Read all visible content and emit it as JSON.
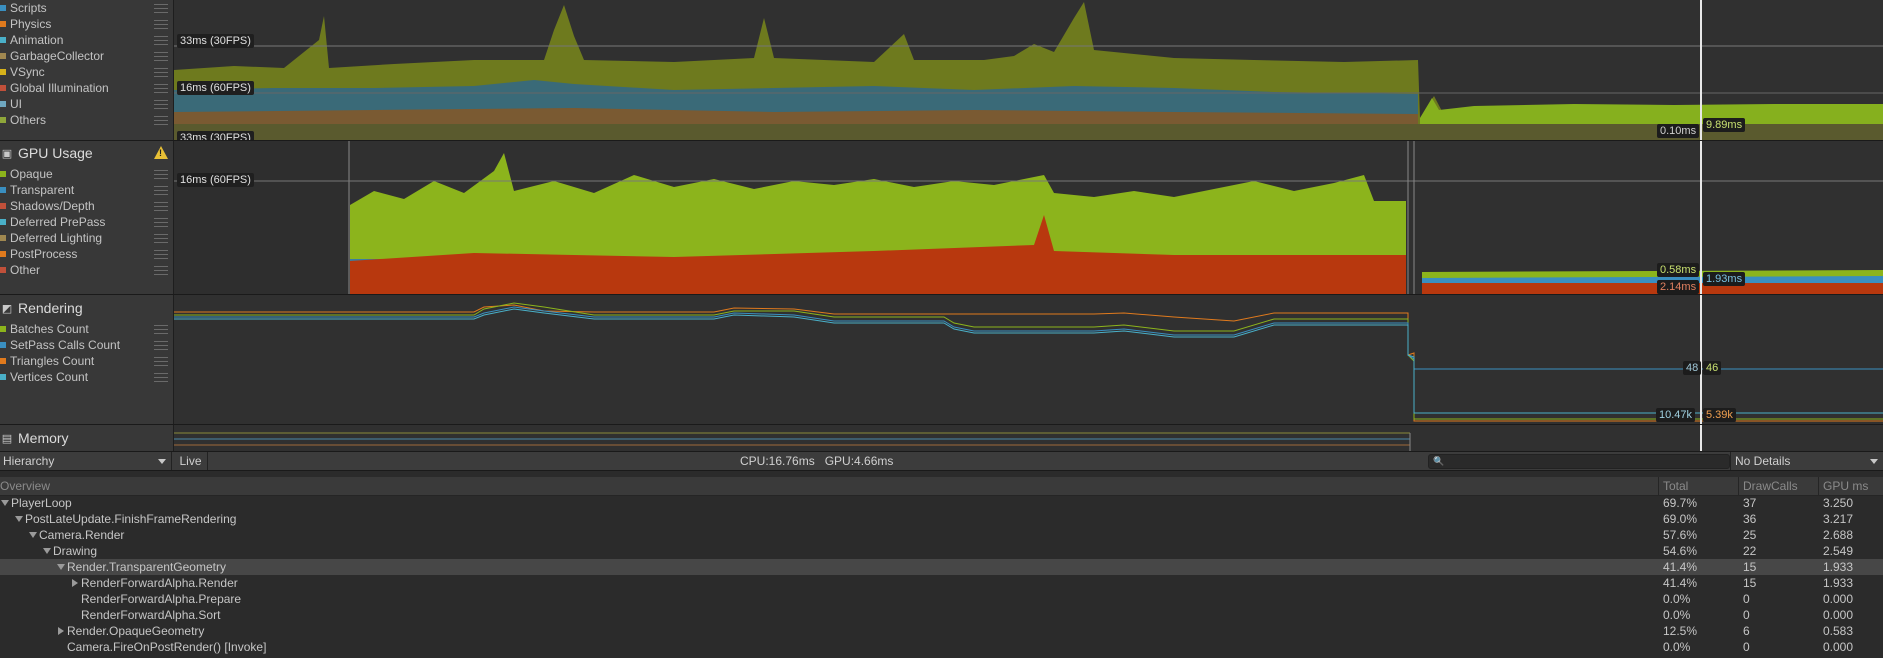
{
  "cpu_module": {
    "legend": [
      {
        "label": "Scripts",
        "color": "#3a8fc0"
      },
      {
        "label": "Physics",
        "color": "#e07a1d"
      },
      {
        "label": "Animation",
        "color": "#4ab0c8"
      },
      {
        "label": "GarbageCollector",
        "color": "#a08850"
      },
      {
        "label": "VSync",
        "color": "#d6b21a"
      },
      {
        "label": "Global Illumination",
        "color": "#c0503a"
      },
      {
        "label": "UI",
        "color": "#6fa8c0"
      },
      {
        "label": "Others",
        "color": "#8ea63a"
      }
    ],
    "ref_top": "33ms (30FPS)",
    "ref_mid": "16ms (60FPS)",
    "ref_bottom": "33ms (30FPS)",
    "tag_a": "0.10ms",
    "tag_b": "9.89ms"
  },
  "gpu_module": {
    "title": "GPU Usage",
    "icon": "gpu-icon",
    "warning_icon": "warning-icon",
    "legend": [
      {
        "label": "Opaque",
        "color": "#8cb41c"
      },
      {
        "label": "Transparent",
        "color": "#3a8fc0"
      },
      {
        "label": "Shadows/Depth",
        "color": "#c0503a"
      },
      {
        "label": "Deferred PrePass",
        "color": "#4ab0c8"
      },
      {
        "label": "Deferred Lighting",
        "color": "#a08850"
      },
      {
        "label": "PostProcess",
        "color": "#e07a1d"
      },
      {
        "label": "Other",
        "color": "#c0503a"
      }
    ],
    "ref_mid": "16ms (60FPS)",
    "tag_a": "0.58ms",
    "tag_b": "1.93ms",
    "tag_c": "2.14ms"
  },
  "rendering_module": {
    "title": "Rendering",
    "icon": "rendering-icon",
    "legend": [
      {
        "label": "Batches Count",
        "color": "#8cb41c"
      },
      {
        "label": "SetPass Calls Count",
        "color": "#3a8fc0"
      },
      {
        "label": "Triangles Count",
        "color": "#e07a1d"
      },
      {
        "label": "Vertices Count",
        "color": "#4ab0c8"
      }
    ],
    "tag_a": "48",
    "tag_b": "46",
    "tag_c": "10.47k",
    "tag_d": "5.39k"
  },
  "memory_module": {
    "title": "Memory",
    "icon": "memory-icon"
  },
  "toolbar": {
    "view_mode": "Hierarchy",
    "live": "Live",
    "stats": "CPU:16.76ms   GPU:4.66ms",
    "search_placeholder": "",
    "details": "No Details"
  },
  "table": {
    "headers": {
      "overview": "Overview",
      "total": "Total",
      "drawcalls": "DrawCalls",
      "gpu_ms": "GPU ms"
    },
    "rows": [
      {
        "name": "PlayerLoop",
        "depth": 0,
        "expand": "down",
        "total": "69.7%",
        "drawcalls": "37",
        "gpu": "3.250"
      },
      {
        "name": "PostLateUpdate.FinishFrameRendering",
        "depth": 1,
        "expand": "down",
        "total": "69.0%",
        "drawcalls": "36",
        "gpu": "3.217"
      },
      {
        "name": "Camera.Render",
        "depth": 2,
        "expand": "down",
        "total": "57.6%",
        "drawcalls": "25",
        "gpu": "2.688"
      },
      {
        "name": "Drawing",
        "depth": 3,
        "expand": "down",
        "total": "54.6%",
        "drawcalls": "22",
        "gpu": "2.549"
      },
      {
        "name": "Render.TransparentGeometry",
        "depth": 4,
        "expand": "down",
        "total": "41.4%",
        "drawcalls": "15",
        "gpu": "1.933",
        "selected": true
      },
      {
        "name": "RenderForwardAlpha.Render",
        "depth": 5,
        "expand": "right",
        "total": "41.4%",
        "drawcalls": "15",
        "gpu": "1.933"
      },
      {
        "name": "RenderForwardAlpha.Prepare",
        "depth": 5,
        "expand": "none",
        "total": "0.0%",
        "drawcalls": "0",
        "gpu": "0.000"
      },
      {
        "name": "RenderForwardAlpha.Sort",
        "depth": 5,
        "expand": "none",
        "total": "0.0%",
        "drawcalls": "0",
        "gpu": "0.000"
      },
      {
        "name": "Render.OpaqueGeometry",
        "depth": 4,
        "expand": "right",
        "total": "12.5%",
        "drawcalls": "6",
        "gpu": "0.583"
      },
      {
        "name": "Camera.FireOnPostRender() [Invoke]",
        "depth": 4,
        "expand": "none",
        "total": "0.0%",
        "drawcalls": "0",
        "gpu": "0.000"
      }
    ]
  }
}
